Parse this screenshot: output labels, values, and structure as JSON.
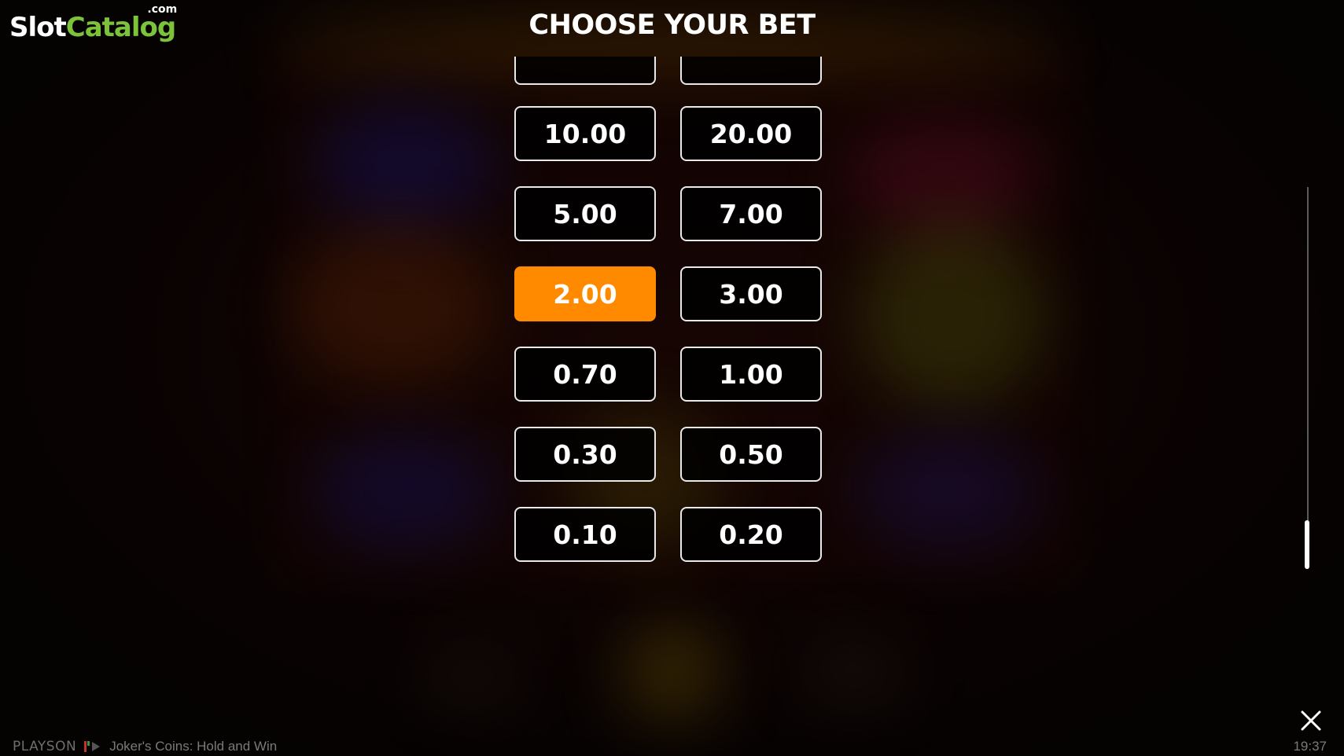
{
  "logo": {
    "slot": "Slot",
    "catalog": "Catalog",
    "dotcom": ".com"
  },
  "title": "CHOOSE YOUR BET",
  "bets": {
    "partial": [
      "",
      ""
    ],
    "rows": [
      [
        "10.00",
        "20.00"
      ],
      [
        "5.00",
        "7.00"
      ],
      [
        "2.00",
        "3.00"
      ],
      [
        "0.70",
        "1.00"
      ],
      [
        "0.30",
        "0.50"
      ],
      [
        "0.10",
        "0.20"
      ]
    ],
    "selected": "2.00"
  },
  "scroll": {
    "position": 1.0
  },
  "footer": {
    "provider": "PLAYSON",
    "game_name": "Joker's Coins: Hold and Win",
    "clock": "19:37"
  },
  "colors": {
    "accent": "#ff8a00",
    "border": "#e9e9e9",
    "logo_green": "#7dc33a"
  },
  "icons": {
    "close": "close-icon",
    "provider": "playson-logo-icon"
  }
}
